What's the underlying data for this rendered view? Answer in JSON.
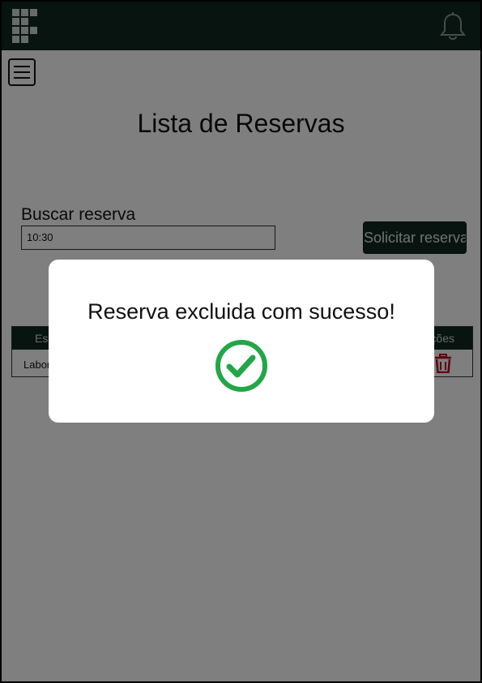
{
  "header": {
    "logo_icon": "institute-logo-icon",
    "notification_icon": "bell-icon"
  },
  "menu": {
    "icon": "hamburger-menu-icon"
  },
  "page": {
    "title": "Lista de Reservas"
  },
  "search": {
    "label": "Buscar reserva",
    "value": "10:30"
  },
  "actions": {
    "request_label": "Solicitar reserva"
  },
  "table": {
    "headers": [
      "Esp",
      "ções"
    ],
    "rows": [
      {
        "space": "Labor",
        "action_icon": "trash-icon"
      }
    ]
  },
  "modal": {
    "message": "Reserva excluida com sucesso!",
    "icon": "check-circle-icon"
  },
  "colors": {
    "primary": "#0f2820",
    "success": "#22a648",
    "danger": "#c0001a"
  }
}
